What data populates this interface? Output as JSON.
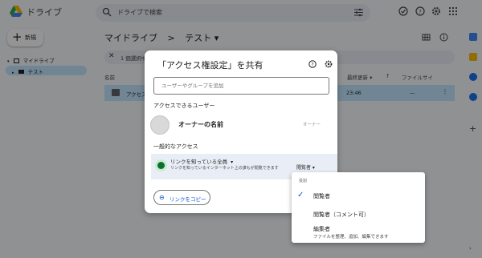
{
  "app": {
    "title": "ドライブ",
    "search_placeholder": "ドライブで検索",
    "new_label": "新規",
    "tree": {
      "root": "マイドライブ",
      "child": "テスト"
    },
    "breadcrumb": {
      "root": "マイドライブ",
      "sep": ">",
      "current": "テスト ▾"
    },
    "selection_text": "1 個選択中",
    "columns": {
      "name": "名前",
      "modified": "最終更新 ▾",
      "size": "ファイルサイ"
    },
    "file": {
      "name": "アクセス",
      "modified": "23:46",
      "size": "—"
    },
    "colors": {
      "selection": "#c2e7ff",
      "accent": "#0b57d0"
    }
  },
  "dialog": {
    "title": "「アクセス権設定」を共有",
    "add_placeholder": "ユーザーやグループを追加",
    "people_heading": "アクセスできるユーザー",
    "owner_name": "オーナーの名前",
    "owner_role": "オーナー",
    "general_heading": "一般的なアクセス",
    "link_access": "リンクを知っている全員",
    "link_desc": "リンクを知っているインターネット上の誰もが閲覧できます",
    "role": "閲覧者 ▾",
    "copy_link": "リンクをコピー"
  },
  "menu": {
    "heading": "役割",
    "options": [
      {
        "label": "閲覧者",
        "selected": true
      },
      {
        "label": "閲覧者（コメント可）"
      },
      {
        "label": "編集者",
        "desc": "ファイルを整理、追加、編集できます"
      }
    ]
  }
}
